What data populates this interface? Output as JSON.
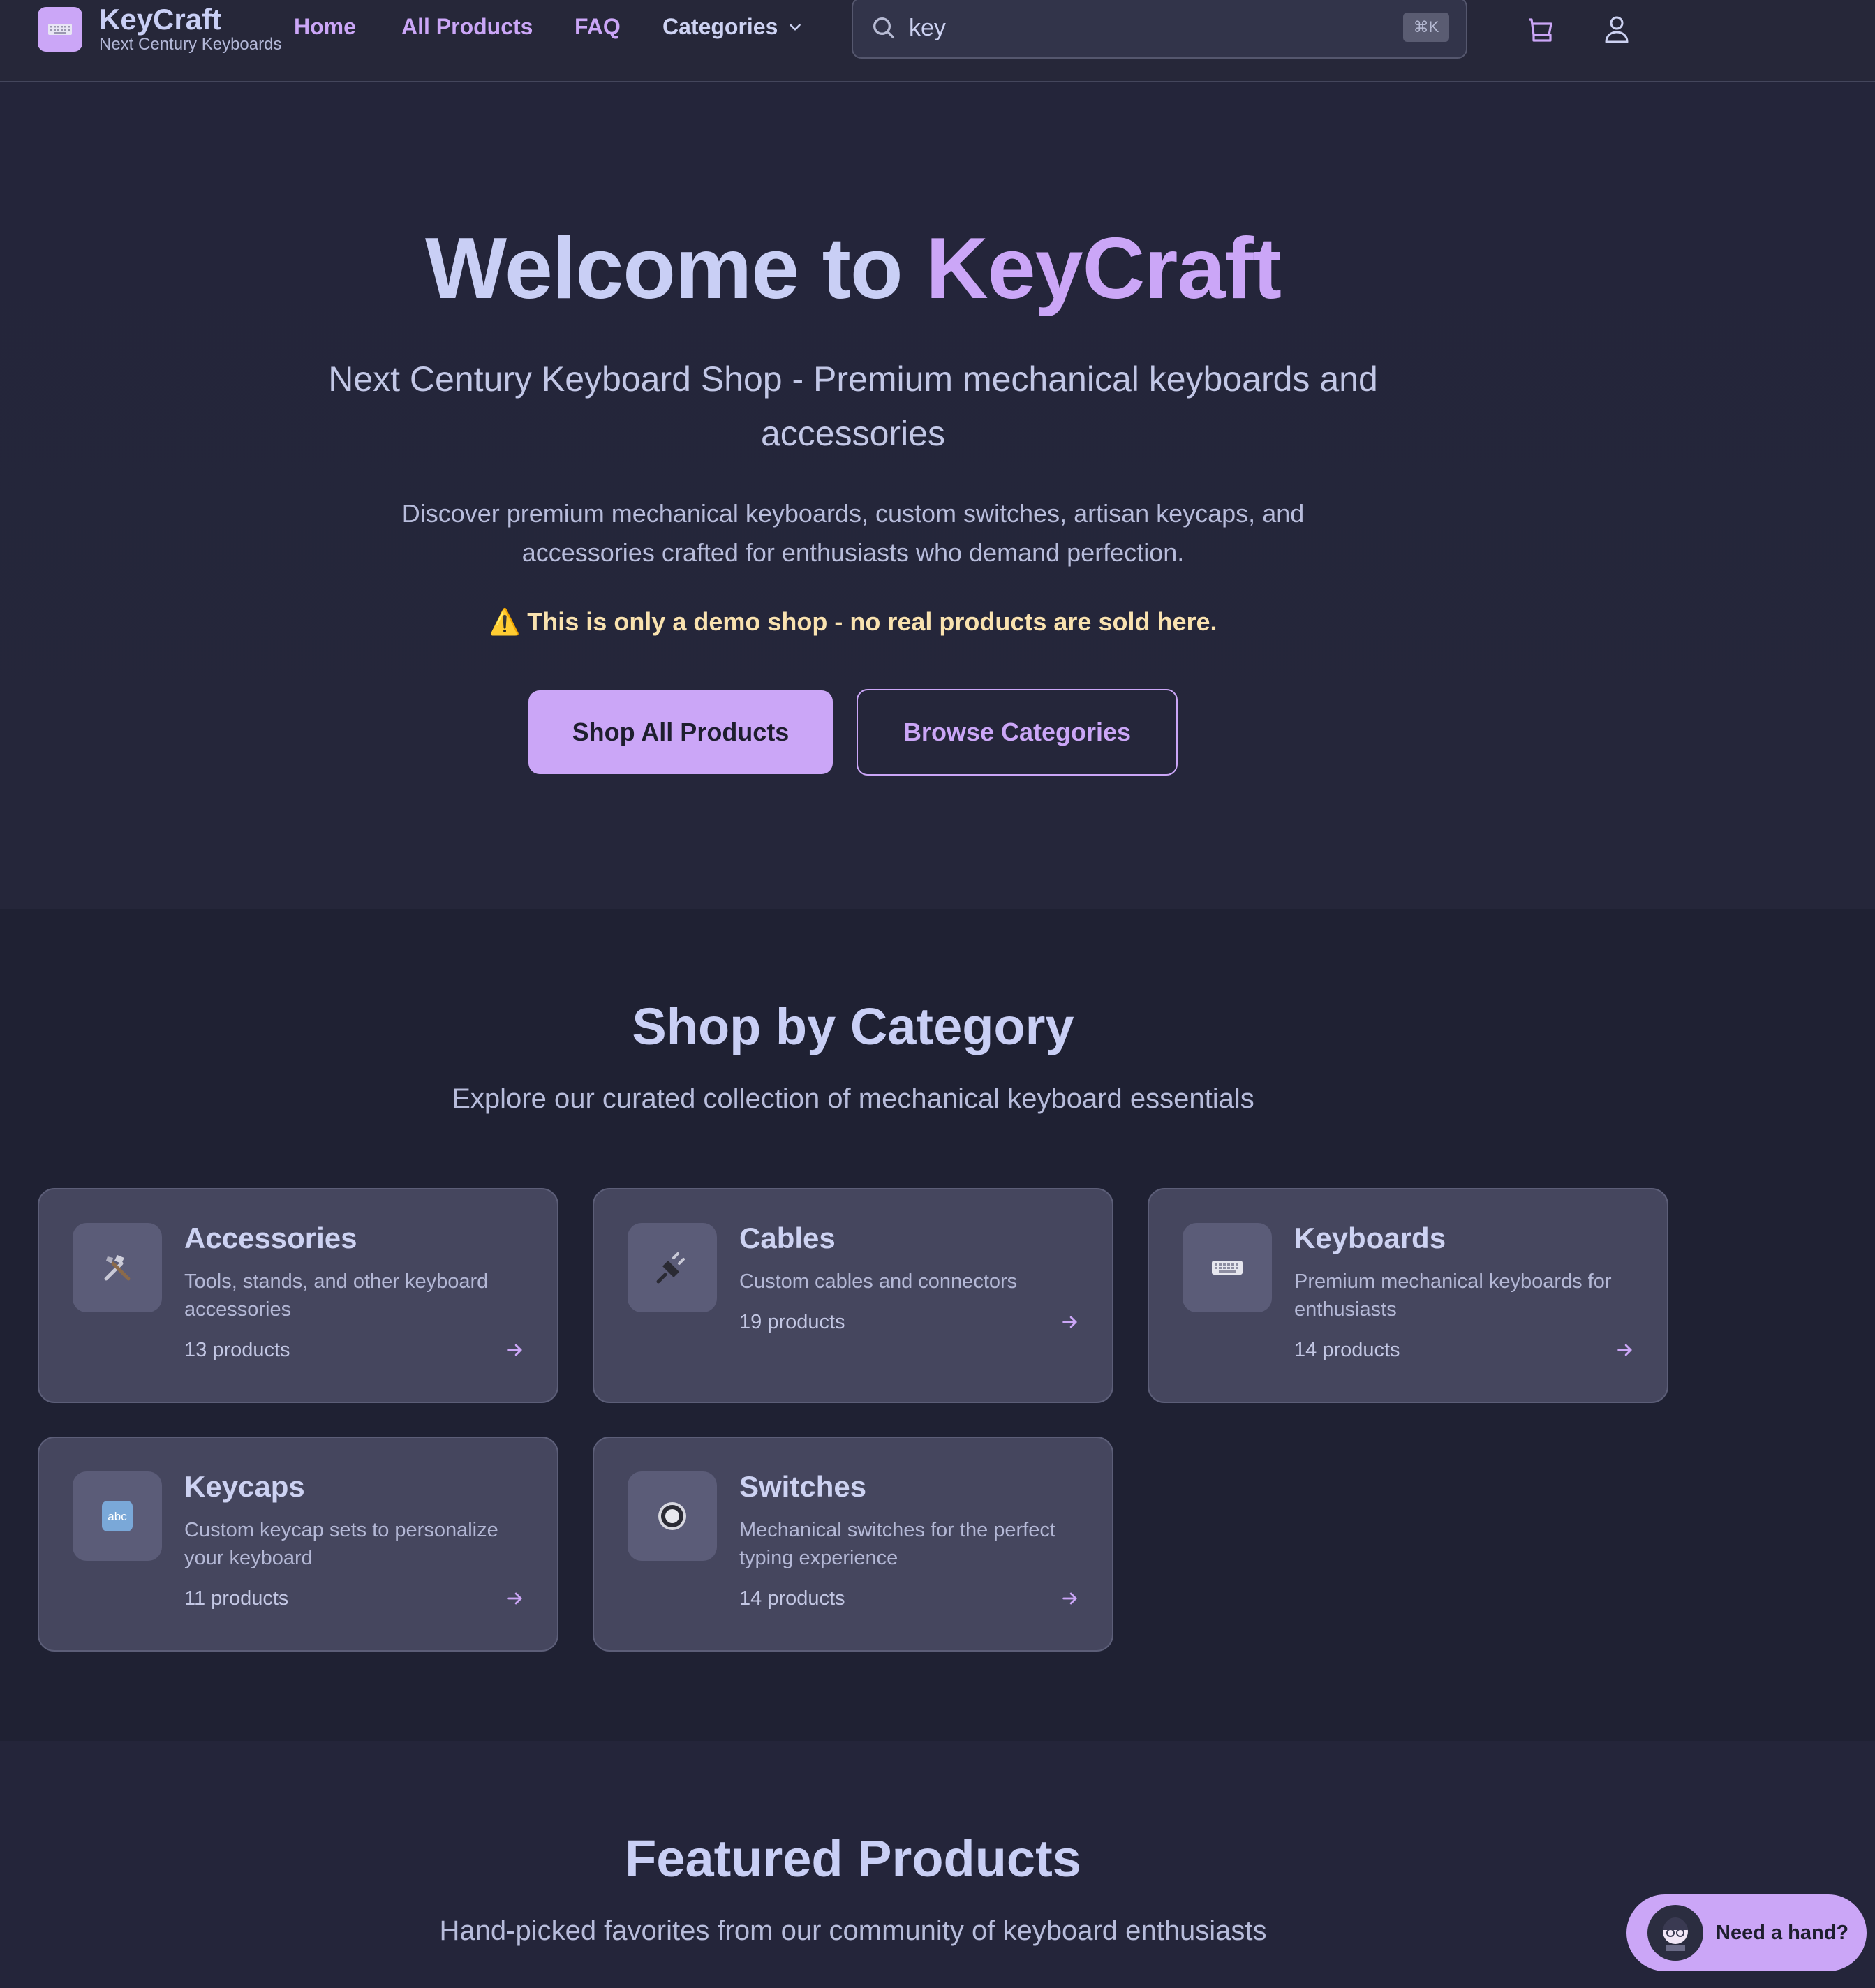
{
  "header": {
    "brand_name": "KeyCraft",
    "brand_sub": "Next Century Keyboards",
    "nav": {
      "home": "Home",
      "all_products": "All Products",
      "faq": "FAQ",
      "categories": "Categories"
    },
    "search": {
      "value": "key",
      "shortcut": "⌘K"
    },
    "icons": [
      "keyboard-icon",
      "search-icon",
      "cart-icon",
      "user-icon",
      "chevron-down-icon"
    ]
  },
  "hero": {
    "title_prefix": "Welcome to ",
    "title_accent": "KeyCraft",
    "subtitle": "Next Century Keyboard Shop - Premium mechanical keyboards and accessories",
    "description": "Discover premium mechanical keyboards, custom switches, artisan keycaps, and accessories crafted for enthusiasts who demand perfection.",
    "warning": "⚠️ This is only a demo shop - no real products are sold here.",
    "primary_button": "Shop All Products",
    "secondary_button": "Browse Categories"
  },
  "categories": {
    "title": "Shop by Category",
    "subtitle": "Explore our curated collection of mechanical keyboard essentials",
    "items": [
      {
        "name": "Accessories",
        "description": "Tools, stands, and other keyboard accessories",
        "count": "13 products",
        "icon": "tools-icon"
      },
      {
        "name": "Cables",
        "description": "Custom cables and connectors",
        "count": "19 products",
        "icon": "plug-icon"
      },
      {
        "name": "Keyboards",
        "description": "Premium mechanical keyboards for enthusiasts",
        "count": "14 products",
        "icon": "keyboard-icon"
      },
      {
        "name": "Keycaps",
        "description": "Custom keycap sets to personalize your keyboard",
        "count": "11 products",
        "icon": "abc-icon"
      },
      {
        "name": "Switches",
        "description": "Mechanical switches for the perfect typing experience",
        "count": "14 products",
        "icon": "radio-button-icon"
      }
    ]
  },
  "featured": {
    "title": "Featured Products",
    "subtitle": "Hand-picked favorites from our community of keyboard enthusiasts"
  },
  "help": {
    "label": "Need a hand?"
  },
  "colors": {
    "accent": "#cba6f7",
    "background": "#1f2133",
    "hero_background": "#24253a",
    "card": "#45465e",
    "warning": "#f9e2af"
  }
}
